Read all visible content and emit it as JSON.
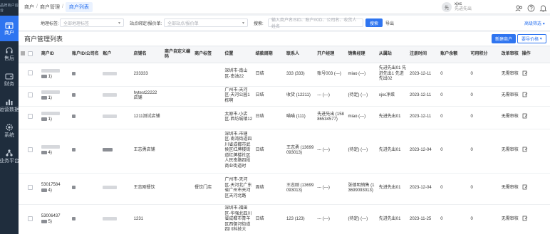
{
  "sidebar": {
    "logo": "品牌商户后台",
    "items": [
      {
        "label": "商户",
        "icon": "store-icon",
        "active": true
      },
      {
        "label": "售后",
        "icon": "headset-icon",
        "active": false
      },
      {
        "label": "财务",
        "icon": "wallet-icon",
        "active": false
      },
      {
        "label": "运营数据",
        "icon": "bar-chart-icon",
        "active": false
      },
      {
        "label": "系统",
        "icon": "gear-icon",
        "active": false
      },
      {
        "label": "业务平台",
        "icon": "cluster-icon",
        "active": false
      }
    ]
  },
  "breadcrumb": [
    "商户",
    "商户管理",
    "商户列表"
  ],
  "user": {
    "avatar": "先",
    "name": "xjxc",
    "sub": "先进先出"
  },
  "filters": {
    "region_label": "地理标签:",
    "region_placeholder": "全部地理标签",
    "point_label": "站点绑定/报价单:",
    "point_placeholder": "全部站点/报价单",
    "search_label": "搜索:",
    "search_placeholder": "输入商户名/SID、账户/KID、公司名、收货人姓名",
    "search_button": "搜索",
    "export_button": "导出",
    "advanced": "高级筛选"
  },
  "page": {
    "title": "商户管理列表",
    "new_button": "新建商户",
    "export_button": "要导价格"
  },
  "table": {
    "headers": [
      "商户ID",
      "账户ID/公司名",
      "账户",
      "店铺名",
      "商户自定义编码",
      "商户标签",
      "位置",
      "结款周期",
      "联系人",
      "开户经理",
      "销售经理",
      "从属站",
      "注册时间",
      "账户余额",
      "可用积分",
      "改单审核",
      "操作"
    ],
    "rows": [
      {
        "id_tail": "1)",
        "shop": "233333",
        "loc": "深圳市-南山区-南油22",
        "cycle": "日结",
        "contact": "333 (333)",
        "open_mgr": "账号003 (---)",
        "sales_mgr": "miao (---)",
        "station": "先进先出01 先进先出1 先进先出02",
        "reg": "2023-12-11",
        "balance": "0",
        "points": "0",
        "audit": "无需审核",
        "tag": ""
      },
      {
        "id_tail": "1)",
        "shop": "hytest22222 店铺",
        "loc": "广州市-天河区-天河公园1栋啊",
        "cycle": "日结",
        "contact": "收货 (12211)",
        "open_mgr": "--- (---)",
        "sales_mgr": "(待定) (---)",
        "station": "xjxc净菜",
        "reg": "2023-12-11",
        "balance": "0",
        "points": "0",
        "audit": "无需审核",
        "tag": ""
      },
      {
        "id_tail": "1)",
        "shop": "1211测试店铺",
        "loc": "太原市-小店区-西坊城镇12",
        "cycle": "日结",
        "contact": "喵喵 (111)",
        "open_mgr": "先进先出 (15886534577)",
        "sales_mgr": "miao (---)",
        "station": "先进先出01",
        "reg": "2023-12-11",
        "balance": "0",
        "points": "0",
        "audit": "无需审核",
        "tag": ""
      },
      {
        "id_tail": "4)",
        "shop": "王志勇店铺",
        "loc": "深圳市-市辖区-南湾街道四川省成都市武侯区红牌楼街道红牌楼社区人民南路四段商业街道时",
        "cycle": "日结",
        "contact": "王志勇 (13699093013)",
        "open_mgr": "--- (---)",
        "sales_mgr": "(待定) (---)",
        "station": "先进先出01",
        "reg": "2023-12-04",
        "balance": "0",
        "points": "0",
        "audit": "无需审核",
        "tag": ""
      },
      {
        "id_top": "53017584",
        "id_tail": "4)",
        "shop": "王志刚餐饮",
        "loc": "广州市-天河区-天河北广东省广州市天河区天河北路",
        "cycle": "周结",
        "contact": "王志刚 (13699093013)",
        "open_mgr": "--- (---)",
        "sales_mgr": "张德明销售 (13699093013)",
        "station": "先进先出01",
        "reg": "2023-12-04",
        "balance": "0",
        "points": "0",
        "audit": "无需审核",
        "tag": "餐饮门店"
      },
      {
        "id_top": "53006437",
        "id_tail": "5)",
        "shop": "1231",
        "loc": "深圳市-福田区-华强北四川省成都市青羊区西御河街道四川科技大",
        "cycle": "日结",
        "contact": "123 (123)",
        "open_mgr": "--- (---)",
        "sales_mgr": "(待定) (---)",
        "station": "先进先出01",
        "reg": "2023-11-25",
        "balance": "0",
        "points": "0",
        "audit": "无需审核",
        "tag": ""
      }
    ]
  }
}
